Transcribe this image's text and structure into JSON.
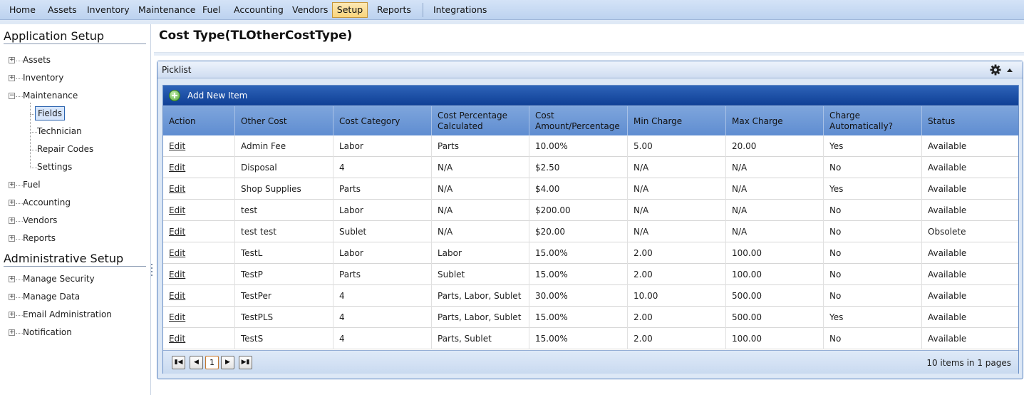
{
  "menu": {
    "items": [
      {
        "label": "Home"
      },
      {
        "label": "Assets"
      },
      {
        "label": "Inventory"
      },
      {
        "label": "Maintenance"
      },
      {
        "label": "Fuel"
      },
      {
        "label": "Accounting"
      },
      {
        "label": "Vendors"
      },
      {
        "label": "Setup",
        "active": true
      },
      {
        "label": "Reports"
      },
      {
        "label": "Integrations"
      }
    ]
  },
  "sidebar": {
    "app_setup_title": "Application Setup",
    "admin_setup_title": "Administrative Setup",
    "app_items": [
      {
        "label": "Assets",
        "toggle": "+"
      },
      {
        "label": "Inventory",
        "toggle": "+"
      },
      {
        "label": "Maintenance",
        "toggle": "−"
      },
      {
        "label": "Fields",
        "selected": true
      },
      {
        "label": "Technician"
      },
      {
        "label": "Repair Codes"
      },
      {
        "label": "Settings"
      },
      {
        "label": "Fuel",
        "toggle": "+"
      },
      {
        "label": "Accounting",
        "toggle": "+"
      },
      {
        "label": "Vendors",
        "toggle": "+"
      },
      {
        "label": "Reports",
        "toggle": "+"
      }
    ],
    "admin_items": [
      {
        "label": "Manage Security",
        "toggle": "+"
      },
      {
        "label": "Manage Data",
        "toggle": "+"
      },
      {
        "label": "Email Administration",
        "toggle": "+"
      },
      {
        "label": "Notification",
        "toggle": "+"
      }
    ]
  },
  "page": {
    "title": "Cost Type(TLOtherCostType)"
  },
  "panel": {
    "title": "Picklist",
    "icons": [
      "gear-icon",
      "collapse-up-icon"
    ]
  },
  "grid": {
    "add_label": "Add New Item",
    "columns": [
      "Action",
      "Other Cost",
      "Cost Category",
      "Cost Percentage Calculated",
      "Cost Amount/Percentage",
      "Min Charge",
      "Max Charge",
      "Charge Automatically?",
      "Status"
    ],
    "rows": [
      [
        "Edit",
        "Admin Fee",
        "Labor",
        "Parts",
        "10.00%",
        "5.00",
        "20.00",
        "Yes",
        "Available"
      ],
      [
        "Edit",
        "Disposal",
        "4",
        "N/A",
        "$2.50",
        "N/A",
        "N/A",
        "No",
        "Available"
      ],
      [
        "Edit",
        "Shop Supplies",
        "Parts",
        "N/A",
        "$4.00",
        "N/A",
        "N/A",
        "Yes",
        "Available"
      ],
      [
        "Edit",
        "test",
        "Labor",
        "N/A",
        "$200.00",
        "N/A",
        "N/A",
        "No",
        "Available"
      ],
      [
        "Edit",
        "test test",
        "Sublet",
        "N/A",
        "$20.00",
        "N/A",
        "N/A",
        "No",
        "Obsolete"
      ],
      [
        "Edit",
        "TestL",
        "Labor",
        "Labor",
        "15.00%",
        "2.00",
        "100.00",
        "No",
        "Available"
      ],
      [
        "Edit",
        "TestP",
        "Parts",
        "Sublet",
        "15.00%",
        "2.00",
        "100.00",
        "No",
        "Available"
      ],
      [
        "Edit",
        "TestPer",
        "4",
        "Parts, Labor, Sublet",
        "30.00%",
        "10.00",
        "500.00",
        "No",
        "Available"
      ],
      [
        "Edit",
        "TestPLS",
        "4",
        "Parts, Labor, Sublet",
        "15.00%",
        "2.00",
        "500.00",
        "Yes",
        "Available"
      ],
      [
        "Edit",
        "TestS",
        "4",
        "Parts, Sublet",
        "15.00%",
        "2.00",
        "100.00",
        "No",
        "Available"
      ]
    ],
    "pager": {
      "first": "first-page-icon",
      "prev": "prev-page-icon",
      "current_page": "1",
      "next": "next-page-icon",
      "last": "last-page-icon",
      "info": "10 items in 1 pages"
    }
  }
}
